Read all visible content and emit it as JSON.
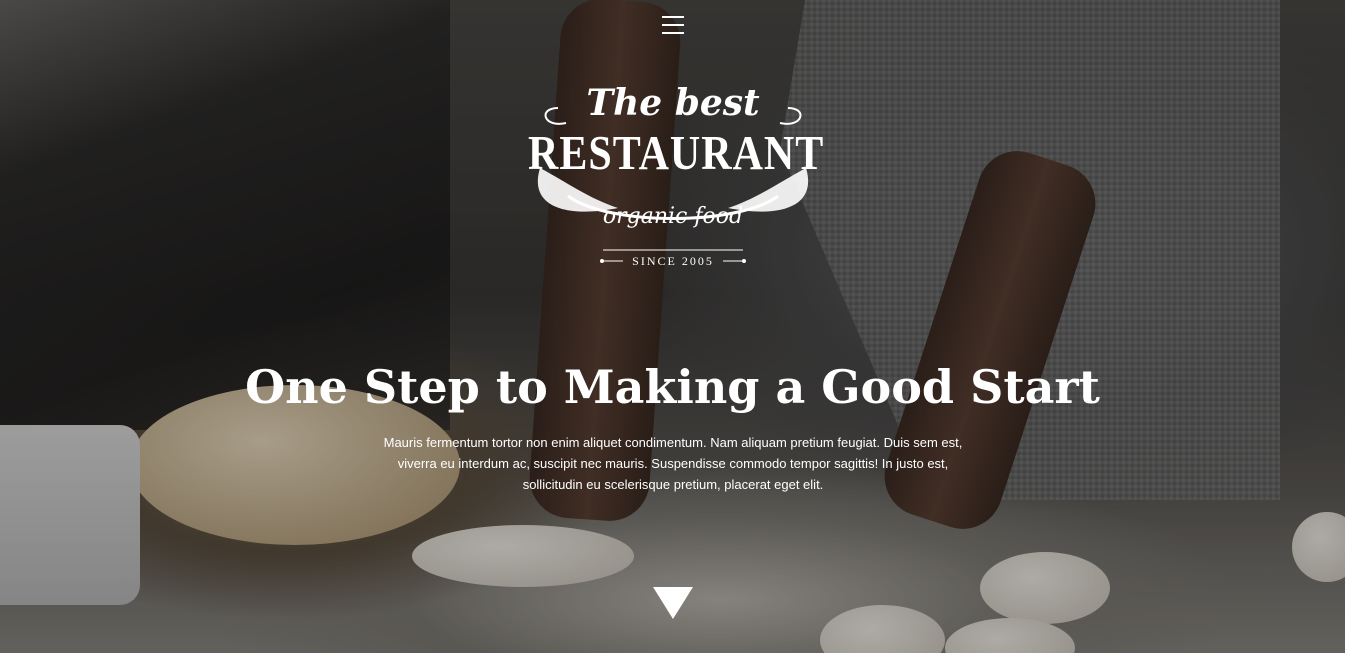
{
  "hero": {
    "headline": "One Step to Making a Good Start",
    "lead": "Mauris fermentum tortor non enim aliquet condimentum. Nam aliquam pretium feugiat. Duis sem est, viverra eu interdum ac, suscipit nec mauris. Suspendisse commodo tempor sagittis! In justo est, sollicitudin eu scelerisque pretium, placerat eget elit."
  },
  "logo": {
    "script": "The best",
    "main": "RESTAURANT",
    "sub": "organic food",
    "since": "SINCE 2005"
  },
  "icons": {
    "menu": "hamburger-menu-icon",
    "scroll": "triangle-down-icon"
  },
  "colors": {
    "text": "#ffffff"
  }
}
